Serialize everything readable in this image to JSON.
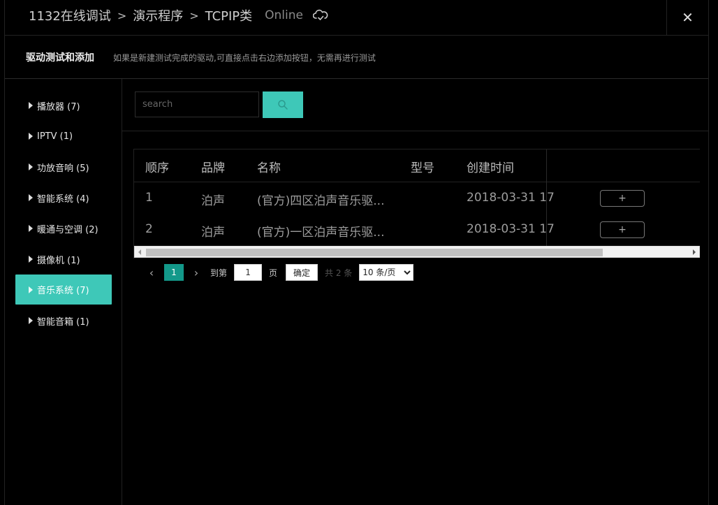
{
  "header": {
    "breadcrumbs": [
      "1132在线调试",
      "演示程序",
      "TCPIP类"
    ],
    "status": "Online",
    "close_label": "✕"
  },
  "subheader": {
    "title": "驱动测试和添加",
    "description": "如果是新建测试完成的驱动,可直接点击右边添加按钮，无需再进行测试"
  },
  "sidebar": {
    "items": [
      {
        "label": "播放器 (7)"
      },
      {
        "label": "IPTV (1)"
      },
      {
        "label": "功放音响 (5)"
      },
      {
        "label": "智能系统 (4)"
      },
      {
        "label": "暖通与空调 (2)"
      },
      {
        "label": "摄像机 (1)"
      },
      {
        "label": "音乐系统 (7)"
      },
      {
        "label": "智能音箱 (1)"
      }
    ],
    "active_index": 6
  },
  "search": {
    "placeholder": "search",
    "value": ""
  },
  "table": {
    "columns": [
      "顺序",
      "品牌",
      "名称",
      "型号",
      "创建时间"
    ],
    "rows": [
      {
        "index": "1",
        "brand": "泊声",
        "name": "(官方)四区泊声音乐驱...",
        "model": "",
        "created": "2018-03-31 17",
        "action": "+"
      },
      {
        "index": "2",
        "brand": "泊声",
        "name": "(官方)一区泊声音乐驱...",
        "model": "",
        "created": "2018-03-31 17",
        "action": "+"
      }
    ]
  },
  "pagination": {
    "current_page": "1",
    "goto_label": "到第",
    "goto_value": "1",
    "page_unit": "页",
    "confirm_label": "确定",
    "total_label": "共 2 条",
    "page_size_options": [
      "10 条/页"
    ]
  },
  "colors": {
    "accent": "#3ec8b8",
    "page_active": "#13998a",
    "background": "#000000"
  }
}
